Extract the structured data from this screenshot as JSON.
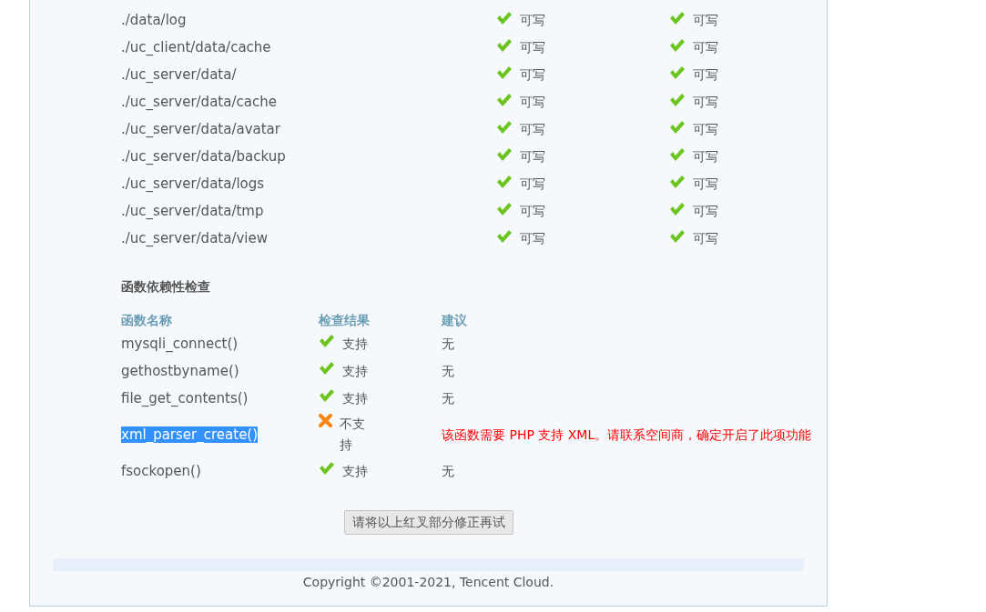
{
  "directories": [
    {
      "path": "./data/log",
      "required": {
        "kind": "ok",
        "text": "可写"
      },
      "current": {
        "kind": "ok",
        "text": "可写"
      }
    },
    {
      "path": "./uc_client/data/cache",
      "required": {
        "kind": "ok",
        "text": "可写"
      },
      "current": {
        "kind": "ok",
        "text": "可写"
      }
    },
    {
      "path": "./uc_server/data/",
      "required": {
        "kind": "ok",
        "text": "可写"
      },
      "current": {
        "kind": "ok",
        "text": "可写"
      }
    },
    {
      "path": "./uc_server/data/cache",
      "required": {
        "kind": "ok",
        "text": "可写"
      },
      "current": {
        "kind": "ok",
        "text": "可写"
      }
    },
    {
      "path": "./uc_server/data/avatar",
      "required": {
        "kind": "ok",
        "text": "可写"
      },
      "current": {
        "kind": "ok",
        "text": "可写"
      }
    },
    {
      "path": "./uc_server/data/backup",
      "required": {
        "kind": "ok",
        "text": "可写"
      },
      "current": {
        "kind": "ok",
        "text": "可写"
      }
    },
    {
      "path": "./uc_server/data/logs",
      "required": {
        "kind": "ok",
        "text": "可写"
      },
      "current": {
        "kind": "ok",
        "text": "可写"
      }
    },
    {
      "path": "./uc_server/data/tmp",
      "required": {
        "kind": "ok",
        "text": "可写"
      },
      "current": {
        "kind": "ok",
        "text": "可写"
      }
    },
    {
      "path": "./uc_server/data/view",
      "required": {
        "kind": "ok",
        "text": "可写"
      },
      "current": {
        "kind": "ok",
        "text": "可写"
      }
    }
  ],
  "function_check": {
    "title": "函数依赖性检查",
    "columns": [
      "函数名称",
      "检查结果",
      "建议"
    ],
    "rows": [
      {
        "name": "mysqli_connect()",
        "selected": false,
        "kind": "ok",
        "result": "支持",
        "advice": "无"
      },
      {
        "name": "gethostbyname()",
        "selected": false,
        "kind": "ok",
        "result": "支持",
        "advice": "无"
      },
      {
        "name": "file_get_contents()",
        "selected": false,
        "kind": "ok",
        "result": "支持",
        "advice": "无"
      },
      {
        "name": "xml_parser_create()",
        "selected": true,
        "kind": "error",
        "result": "不支持",
        "advice": "该函数需要 PHP 支持 XML。请联系空间商，确定开启了此项功能"
      },
      {
        "name": "fsockopen()",
        "selected": false,
        "kind": "ok",
        "result": "支持",
        "advice": "无"
      }
    ]
  },
  "retry_button": "请将以上红叉部分修正再试",
  "footer": "Copyright ©2001-2021, Tencent Cloud."
}
